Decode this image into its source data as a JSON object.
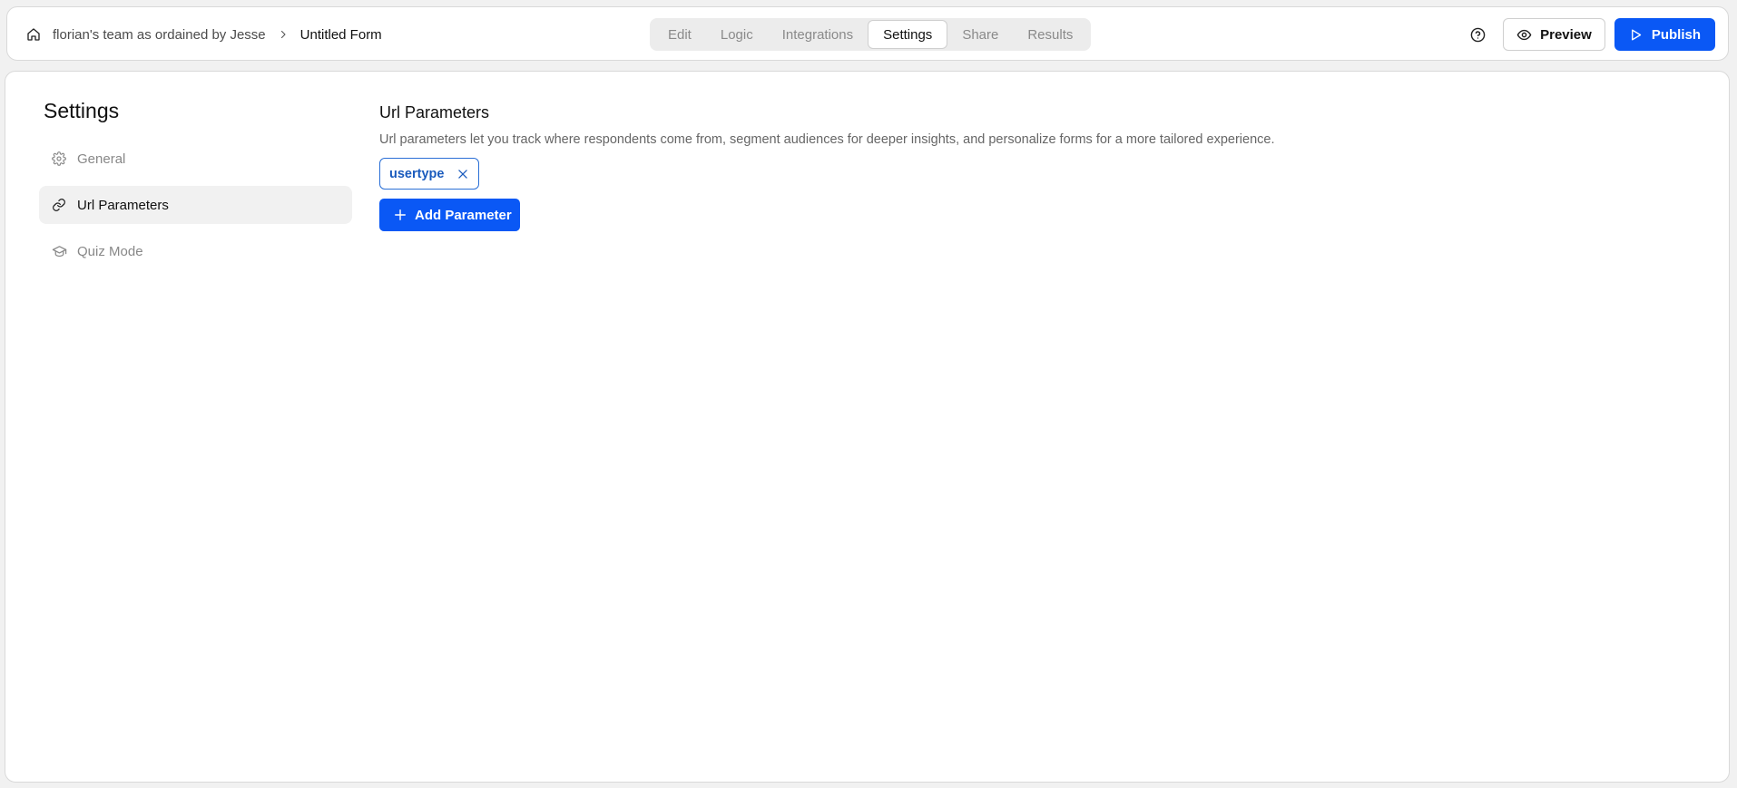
{
  "header": {
    "breadcrumb": {
      "team": "florian's team as ordained by Jesse",
      "form": "Untitled Form"
    },
    "tabs": [
      {
        "label": "Edit",
        "active": false
      },
      {
        "label": "Logic",
        "active": false
      },
      {
        "label": "Integrations",
        "active": false
      },
      {
        "label": "Settings",
        "active": true
      },
      {
        "label": "Share",
        "active": false
      },
      {
        "label": "Results",
        "active": false
      }
    ],
    "preview_label": "Preview",
    "publish_label": "Publish"
  },
  "sidebar": {
    "title": "Settings",
    "items": [
      {
        "label": "General",
        "icon": "gear-icon",
        "active": false
      },
      {
        "label": "Url Parameters",
        "icon": "link-icon",
        "active": true
      },
      {
        "label": "Quiz Mode",
        "icon": "graduation-cap-icon",
        "active": false
      }
    ]
  },
  "main": {
    "title": "Url Parameters",
    "description": "Url parameters let you track where respondents come from, segment audiences for deeper insights, and personalize forms for a more tailored experience.",
    "parameters": [
      "usertype"
    ],
    "add_button_label": "Add Parameter"
  },
  "colors": {
    "accent": "#0a58f5",
    "chip_border": "#2a6fd6",
    "chip_text": "#1a5bbd"
  }
}
